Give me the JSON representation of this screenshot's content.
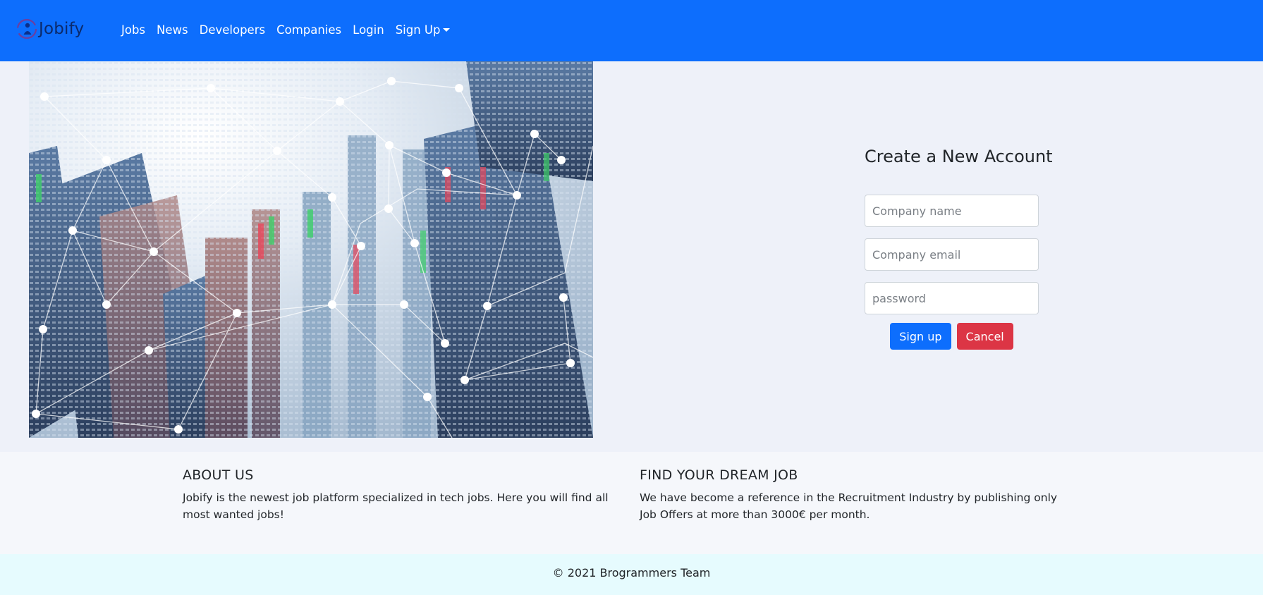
{
  "navbar": {
    "brand": "Jobify",
    "links": [
      "Jobs",
      "News",
      "Developers",
      "Companies",
      "Login"
    ],
    "signup_dropdown": "Sign Up",
    "bg_color": "#0d6efd"
  },
  "hero": {
    "icon": "city-network-image"
  },
  "signup_form": {
    "title": "Create a New Account",
    "company_name_placeholder": "Company name",
    "company_email_placeholder": "Company email",
    "password_placeholder": "password",
    "submit_label": "Sign up",
    "cancel_label": "Cancel",
    "submit_color": "#0d6efd",
    "cancel_color": "#dc3545"
  },
  "footer": {
    "about_title": "ABOUT US",
    "about_text": "Jobify is the newest job platform specialized in tech jobs. Here you will find all most wanted jobs!",
    "dream_title": "FIND YOUR DREAM JOB",
    "dream_text": "We have become a reference in the Recruitment Industry by publishing only Job Offers at more than 3000€ per month.",
    "copyright": "© 2021 Brogrammers Team"
  }
}
